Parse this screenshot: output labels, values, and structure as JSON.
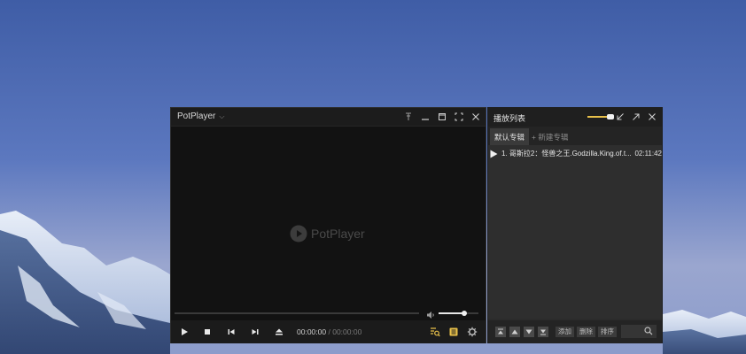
{
  "colors": {
    "accent": "#e8c04a",
    "player_bg": "#131313",
    "playlist_bg": "#2e2e2e",
    "sky": "#5c78bf"
  },
  "player": {
    "app_name": "PotPlayer",
    "watermark": "PotPlayer",
    "time_current": "00:00:00",
    "time_separator": "/",
    "time_total": "00:00:00",
    "volume_level": 0.65,
    "window_buttons": [
      "pin-icon",
      "minimize-icon",
      "maximize-icon",
      "fullscreen-icon",
      "close-icon"
    ],
    "controls": [
      "play-icon",
      "stop-icon",
      "previous-icon",
      "next-icon",
      "eject-icon",
      "playlist-search-icon",
      "playlist-toggle-icon",
      "settings-gear-icon"
    ]
  },
  "playlist": {
    "title": "播放列表",
    "volume_level": 0.85,
    "tabs": {
      "active": "默认专辑",
      "new": "+ 新建专辑"
    },
    "items": [
      {
        "name": "1. 哥斯拉2：怪兽之王.Godzilla.King.of.t...",
        "duration": "02:11:42"
      }
    ],
    "footer": {
      "add": "添加",
      "remove": "删除",
      "sort": "排序"
    }
  }
}
